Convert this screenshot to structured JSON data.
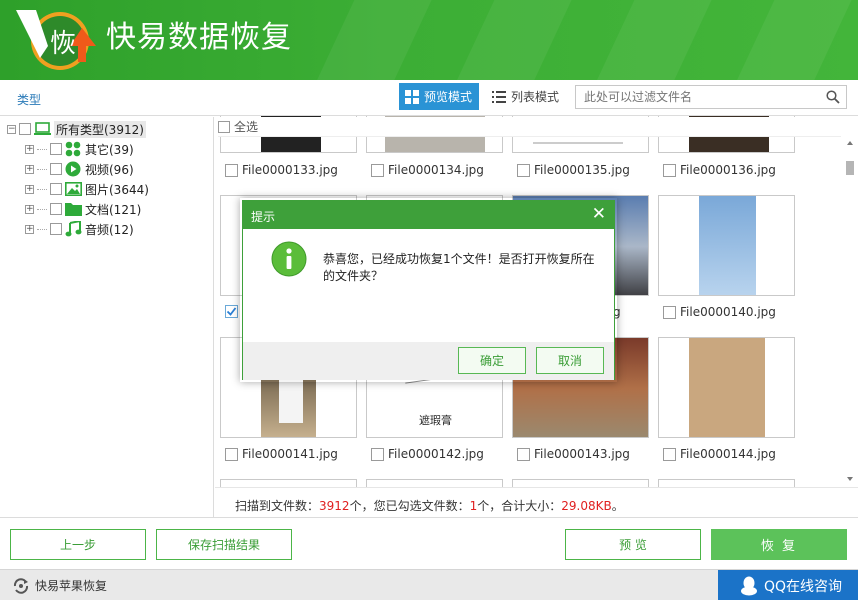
{
  "header": {
    "title": "快易数据恢复",
    "logo_char": "恢"
  },
  "toolbar": {
    "type_label": "类型",
    "preview_mode": "预览模式",
    "list_mode": "列表模式",
    "filter_placeholder": "此处可以过滤文件名"
  },
  "tree": {
    "root": "所有类型(3912)",
    "items": [
      {
        "label": "其它(39)",
        "icon": "apps-icon"
      },
      {
        "label": "视频(96)",
        "icon": "play-icon"
      },
      {
        "label": "图片(3644)",
        "icon": "image-icon"
      },
      {
        "label": "文档(121)",
        "icon": "folder-icon"
      },
      {
        "label": "音频(12)",
        "icon": "music-icon"
      }
    ]
  },
  "grid": {
    "select_all": "全选",
    "files": [
      {
        "name": "File0000133.jpg",
        "checked": false
      },
      {
        "name": "File0000134.jpg",
        "checked": false
      },
      {
        "name": "File0000135.jpg",
        "checked": false
      },
      {
        "name": "File0000136.jpg",
        "checked": false
      },
      {
        "name": "",
        "checked": true
      },
      {
        "name": "",
        "checked": false
      },
      {
        "name": "g",
        "checked": false
      },
      {
        "name": "File0000140.jpg",
        "checked": false
      },
      {
        "name": "File0000141.jpg",
        "checked": false
      },
      {
        "name": "File0000142.jpg",
        "checked": false
      },
      {
        "name": "File0000143.jpg",
        "checked": false
      },
      {
        "name": "File0000144.jpg",
        "checked": false
      }
    ]
  },
  "status": {
    "prefix": "扫描到文件数：",
    "scanned": "3912",
    "mid1": "个，您已勾选文件数：",
    "selected": "1",
    "mid2": "个，合计大小：",
    "size": "29.08KB",
    "suffix": "。"
  },
  "buttons": {
    "back": "上一步",
    "save_scan": "保存扫描结果",
    "preview": "预 览",
    "recover": "恢 复"
  },
  "footer": {
    "brand": "快易苹果恢复",
    "qq": "QQ在线咨询"
  },
  "dialog": {
    "title": "提示",
    "message": "恭喜您，已经成功恢复1个文件！是否打开恢复所在的文件夹？",
    "confirm": "确定",
    "cancel": "取消"
  },
  "colors": {
    "brand_green": "#3ea03a",
    "accent_blue": "#2a93d5",
    "alert_red": "#e02020",
    "qq_blue": "#1b73c8"
  }
}
